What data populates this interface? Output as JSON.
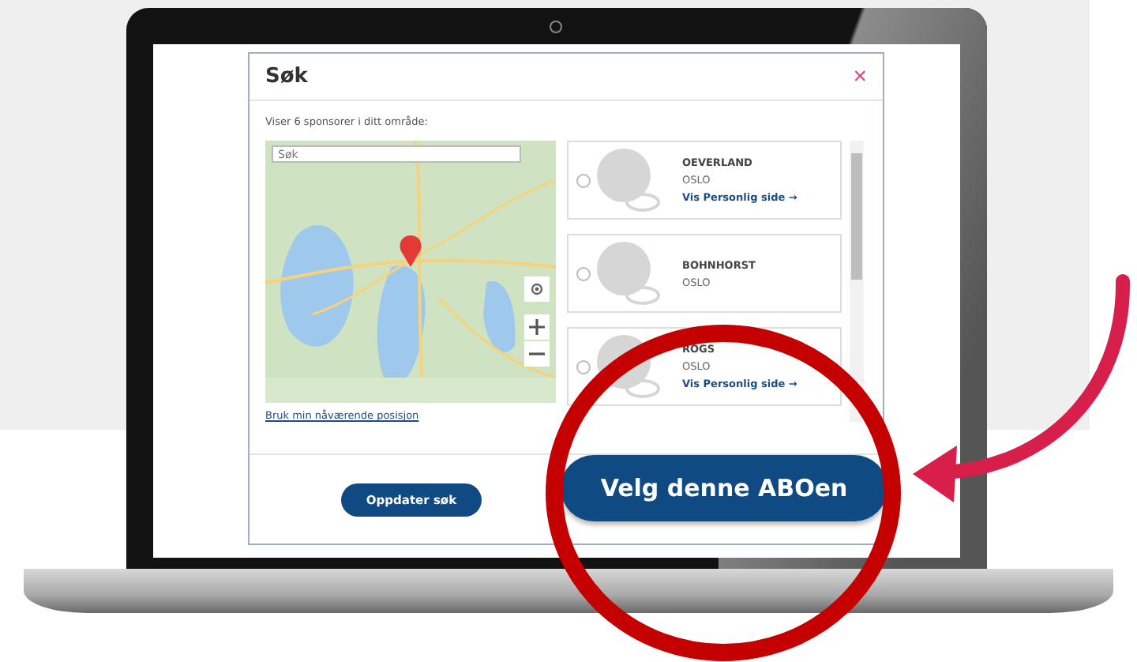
{
  "modal": {
    "title": "Søk",
    "close": "×",
    "summary": "Viser 6 sponsorer i ditt område:",
    "map": {
      "kind": "picture",
      "search": {
        "placeholder": "Søk"
      }
    },
    "location_link": "Bruk min nåværende posisjon",
    "sponsors": [
      {
        "name": "OEVERLAND",
        "city": "OSLO",
        "link": "Vis Personlig side →",
        "selected": false
      },
      {
        "name": "BOHNHORST",
        "city": "OSLO",
        "selected": false
      },
      {
        "name": "ROGS",
        "city": "OSLO",
        "link": "Vis Personlig side →",
        "selected": false
      }
    ],
    "update_button": "Oppdater søk"
  },
  "choose_button": "Velg denne ABOen"
}
